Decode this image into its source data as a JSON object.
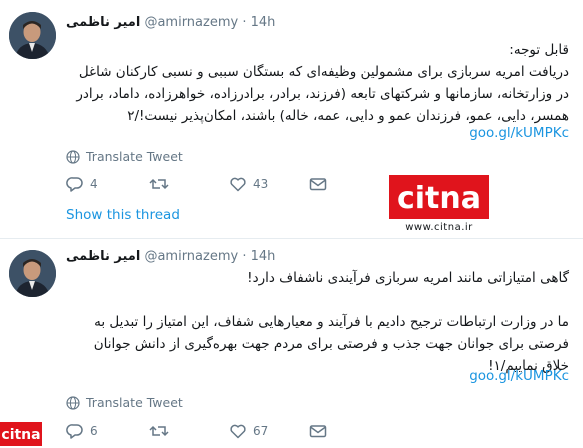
{
  "tweets": [
    {
      "author_name": "امیر ناظمی",
      "handle": "@amirnazemy",
      "separator": "·",
      "time": "14h",
      "lines": [
        "قابل توجه:",
        "دریافت امریه سربازی برای مشمولین وظیفه‌ای که بستگان سببی و نسبی کارکنان شاغل",
        "در وزارتخانه، سازمانها و شرکتهای تابعه (فرزند، برادر، برادرزاده، خواهرزاده، داماد، برادر",
        "همسر، دایی، عمو، فرزندان عمو و دایی، عمه، خاله) باشند، امکان‌پذیر نیست!/۲"
      ],
      "link": "goo.gl/kUMPKc",
      "translate": "Translate Tweet",
      "replies": "4",
      "retweets": "",
      "likes": "43",
      "show_thread": "Show this thread"
    },
    {
      "author_name": "امیر ناظمی",
      "handle": "@amirnazemy",
      "separator": "·",
      "time": "14h",
      "lines": [
        "گاهی امتیازاتی مانند امریه سربازی فرآیندی ناشفاف دارد!",
        "ما در وزارت ارتباطات ترجیح دادیم با فرآیند و معیارهایی شفاف، این امتیاز را تبدیل به",
        "فرصتی برای جوانان جهت جذب و فرصتی برای مردم جهت بهره‌گیری از دانش جوانان",
        "خلاق نماییم/۱!"
      ],
      "link": "goo.gl/kUMPKc",
      "translate": "Translate Tweet",
      "replies": "6",
      "retweets": "",
      "likes": "67"
    }
  ],
  "watermark": {
    "logo_text": "citna",
    "url": "www.citna.ir",
    "brand_color": "#e0141c"
  }
}
